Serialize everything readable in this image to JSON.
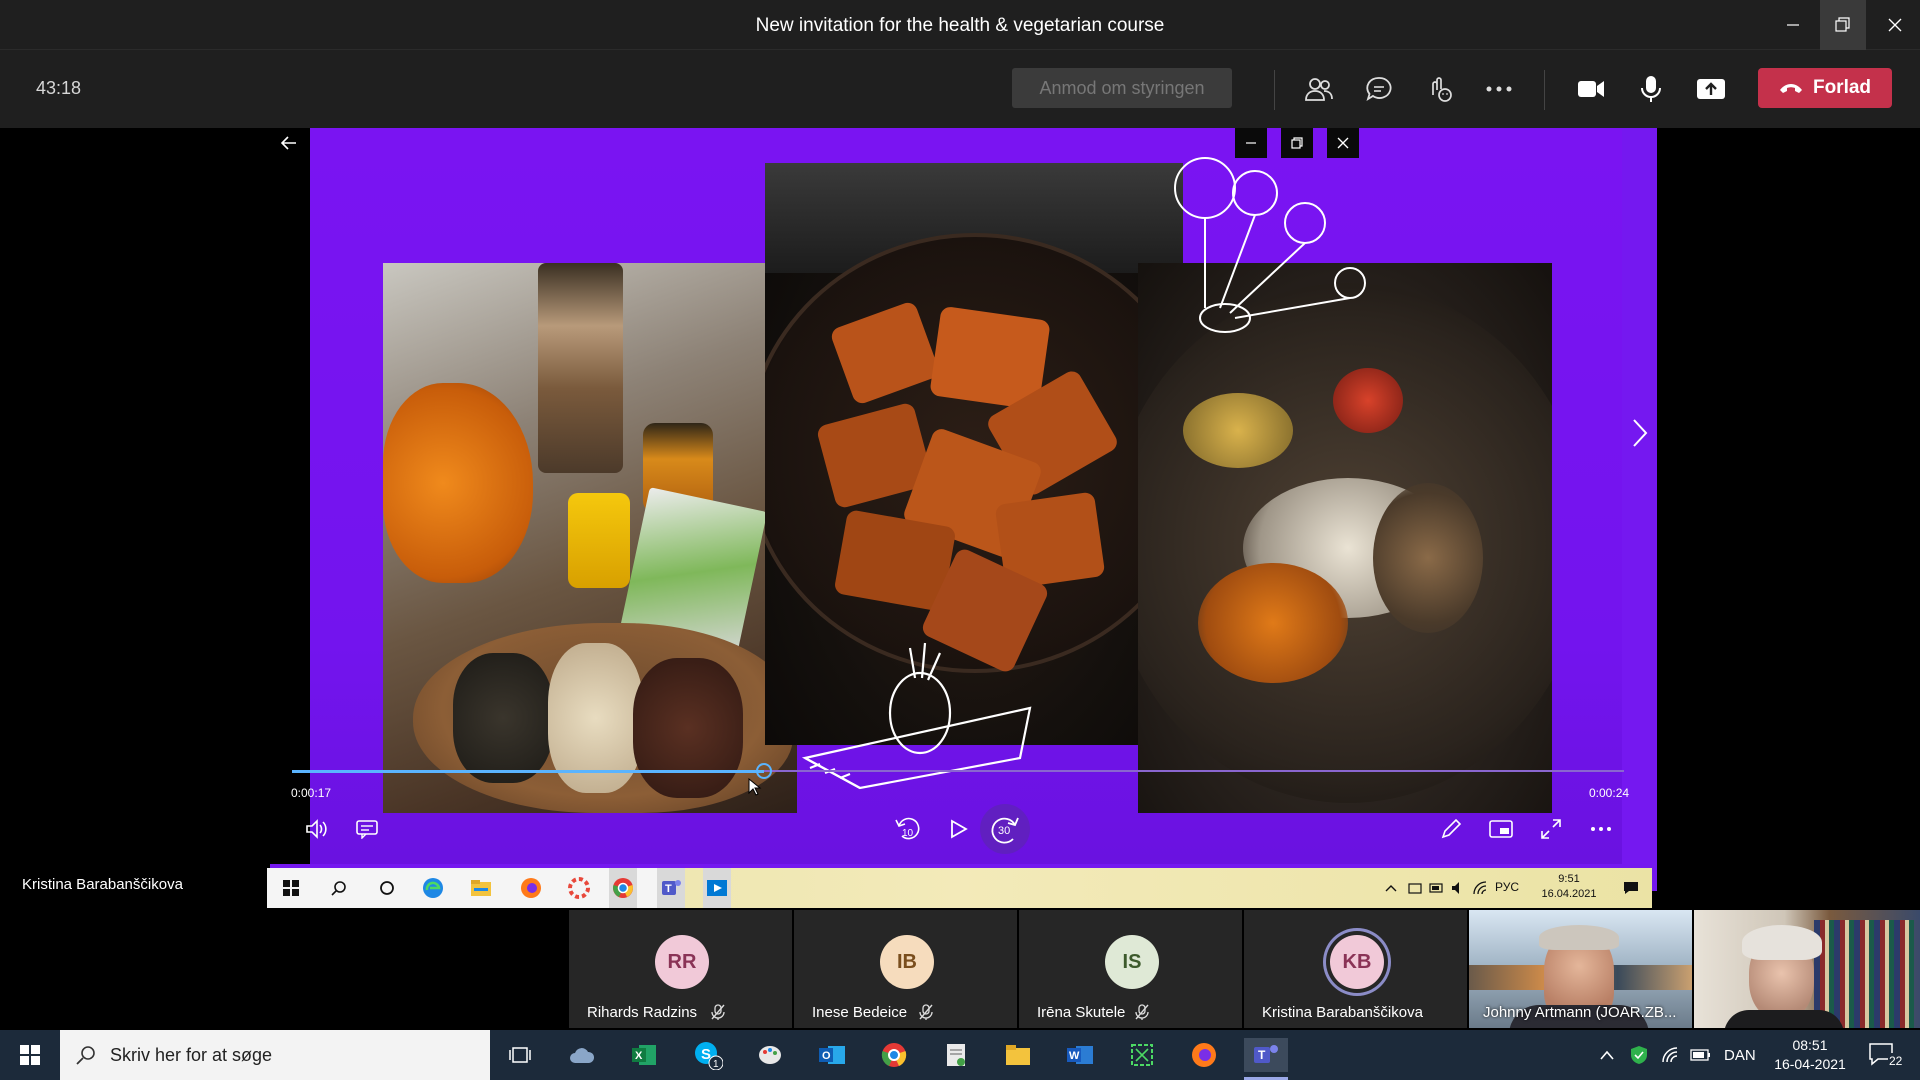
{
  "window": {
    "title": "New invitation for the health & vegetarian course",
    "minimize_icon": "minimize-icon",
    "restore_icon": "restore-icon",
    "close_icon": "close-icon"
  },
  "meeting_bar": {
    "timer": "43:18",
    "request_control_label": "Anmod om styringen",
    "leave_label": "Forlad",
    "leave_color": "#c4314b"
  },
  "shared_screen": {
    "presenter_name": "Kristina Barabanščikova",
    "accent_color": "#7518f0",
    "player": {
      "current_time": "0:00:17",
      "total_time": "0:00:24",
      "progress_fraction": 0.354,
      "skip_back_label": "10",
      "skip_forward_label": "30"
    },
    "inner_taskbar": {
      "language": "РУС",
      "time": "9:51",
      "date": "16.04.2021"
    }
  },
  "participants": [
    {
      "initials": "RR",
      "name": "Rihards Radzins",
      "avatar_bg": "#f1c9d8",
      "avatar_fg": "#8a3356",
      "muted": true
    },
    {
      "initials": "IB",
      "name": "Inese Bedeice",
      "avatar_bg": "#f6dcbd",
      "avatar_fg": "#7a4e1d",
      "muted": true
    },
    {
      "initials": "IS",
      "name": "Irēna Skutele",
      "avatar_bg": "#dfe9d6",
      "avatar_fg": "#3d5a2c",
      "muted": true
    },
    {
      "initials": "KB",
      "name": "Kristina Barabanščikova",
      "avatar_bg": "#f1c9d8",
      "avatar_fg": "#8a3356",
      "muted": false
    },
    {
      "initials": "",
      "name": "Johnny Artmann (JOAR.ZB...",
      "video": true
    },
    {
      "initials": "",
      "name": "",
      "video": true
    }
  ],
  "taskbar": {
    "search_placeholder": "Skriv her for at søge",
    "skype_badge": "1",
    "language": "DAN",
    "time": "08:51",
    "date": "16-04-2021",
    "notifications_count": "22"
  }
}
